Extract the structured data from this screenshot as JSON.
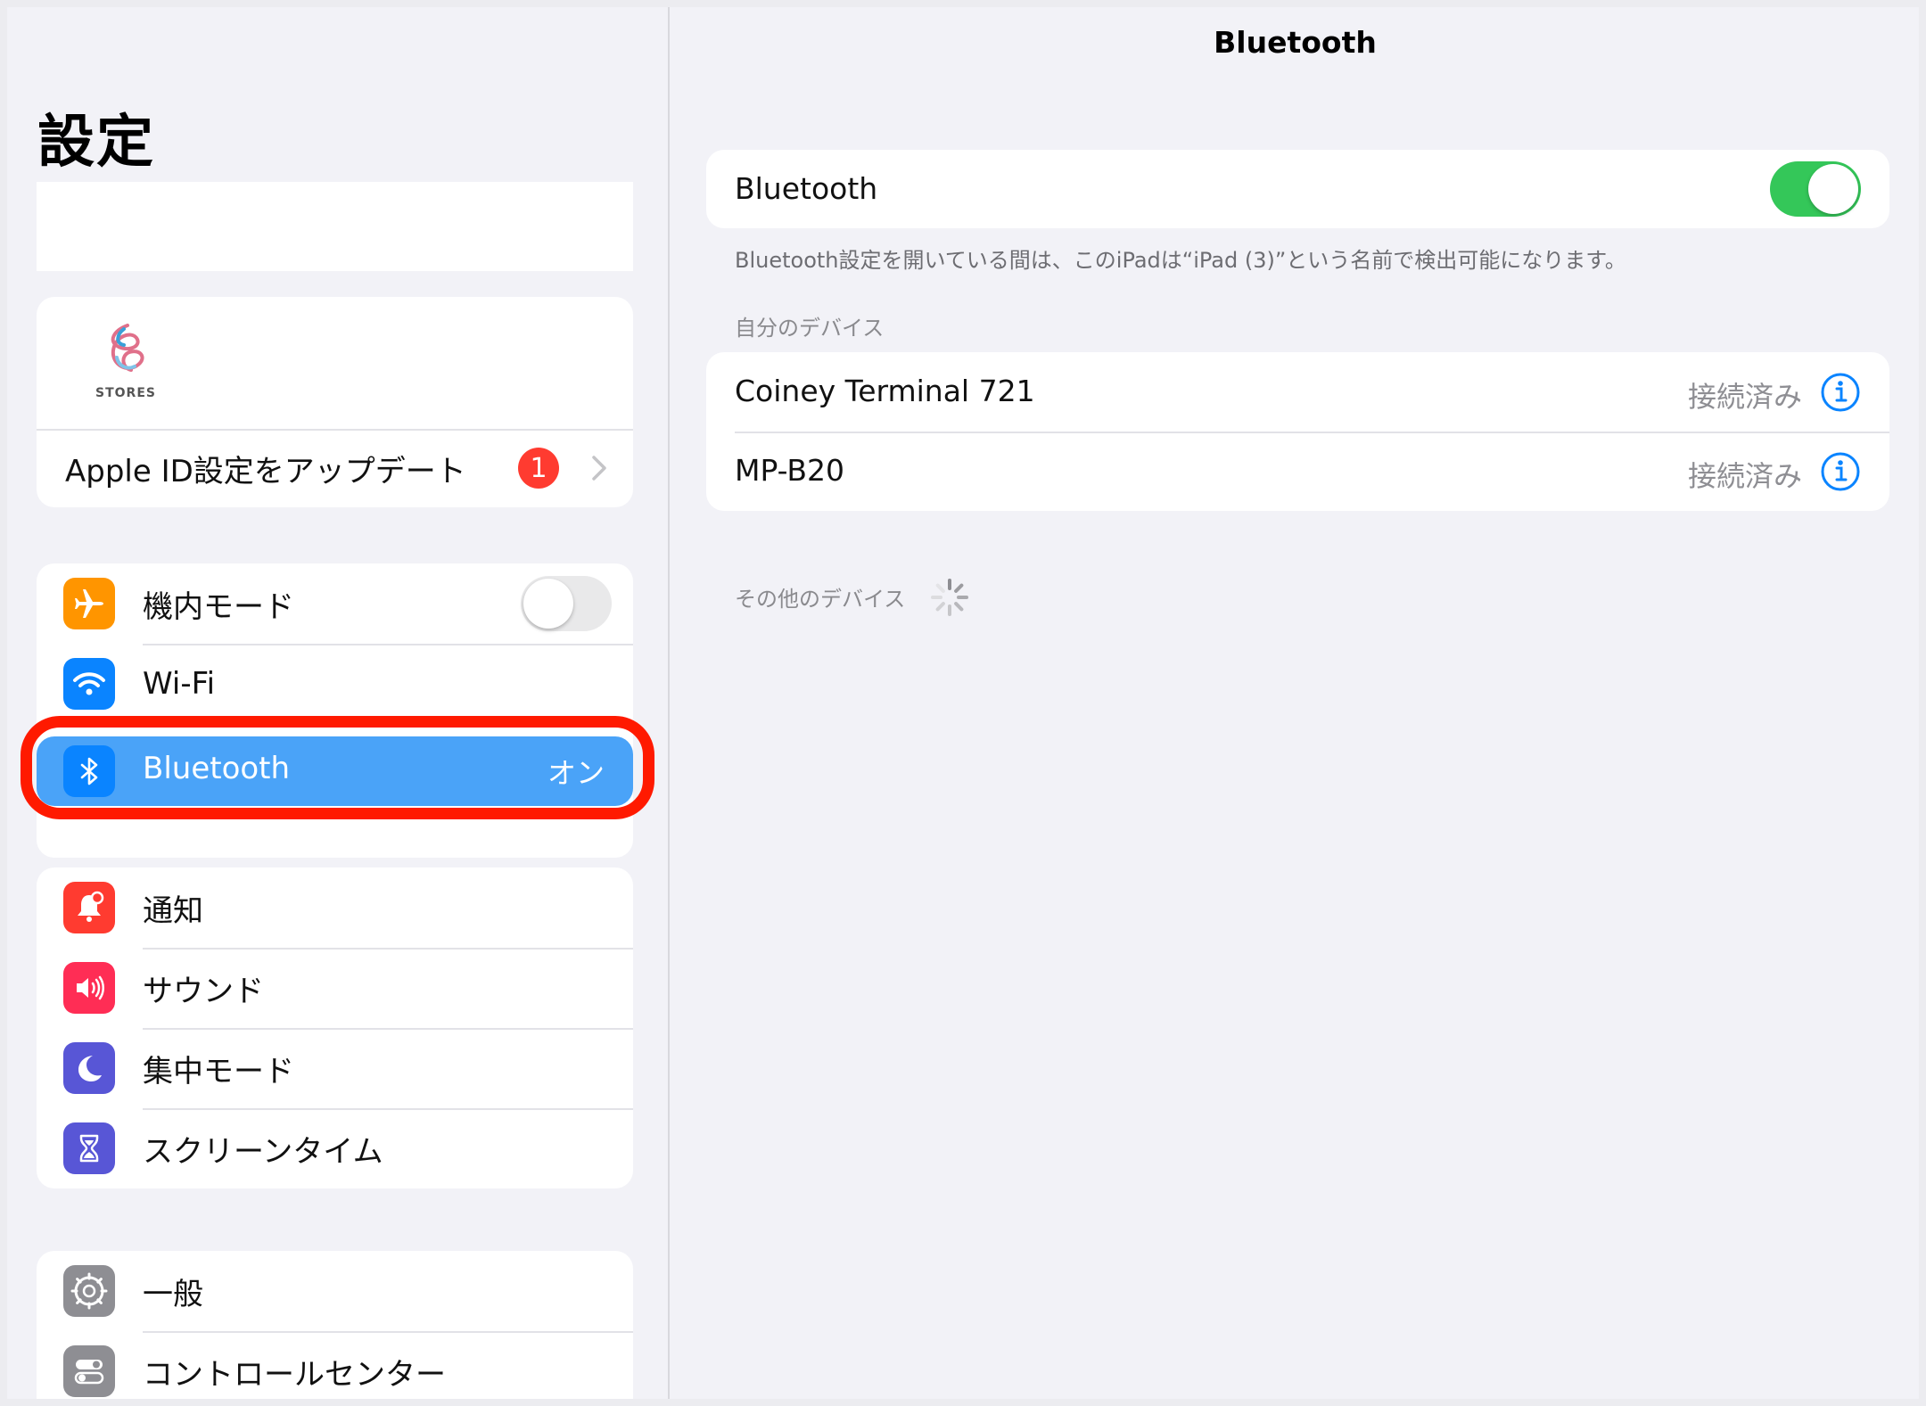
{
  "sidebar": {
    "title": "設定",
    "profile": {
      "logo_text": "STORES",
      "apple_id_update_label": "Apple ID設定をアップデート",
      "badge_count": "1"
    },
    "group1": [
      {
        "label": "機内モード",
        "icon": "airplane-icon",
        "color": "#ff9500",
        "toggle": "off"
      },
      {
        "label": "Wi-Fi",
        "icon": "wifi-icon",
        "color": "#0a84ff"
      },
      {
        "label": "Bluetooth",
        "icon": "bluetooth-icon",
        "color": "#0a84ff",
        "value": "オン",
        "selected": true
      }
    ],
    "group2": [
      {
        "label": "通知",
        "icon": "bell-icon",
        "color": "#ff3b30"
      },
      {
        "label": "サウンド",
        "icon": "speaker-icon",
        "color": "#ff2d55"
      },
      {
        "label": "集中モード",
        "icon": "moon-icon",
        "color": "#5856d6"
      },
      {
        "label": "スクリーンタイム",
        "icon": "hourglass-icon",
        "color": "#5856d6"
      }
    ],
    "group3": [
      {
        "label": "一般",
        "icon": "gear-icon",
        "color": "#8e8e93"
      },
      {
        "label": "コントロールセンター",
        "icon": "switches-icon",
        "color": "#8e8e93"
      }
    ]
  },
  "detail": {
    "nav_title": "Bluetooth",
    "bluetooth_toggle_label": "Bluetooth",
    "bluetooth_state": "on",
    "footnote": "Bluetooth設定を開いている間は、このiPadは“iPad (3)”という名前で検出可能になります。",
    "my_devices_header": "自分のデバイス",
    "my_devices": [
      {
        "name": "Coiney Terminal 721",
        "status": "接続済み"
      },
      {
        "name": "MP-B20",
        "status": "接続済み"
      }
    ],
    "other_devices_header": "その他のデバイス"
  },
  "colors": {
    "accent": "#0a84ff",
    "toggle_on": "#34c759",
    "selected_row": "#4aa3f8",
    "highlight_ring": "#ff1a00"
  }
}
